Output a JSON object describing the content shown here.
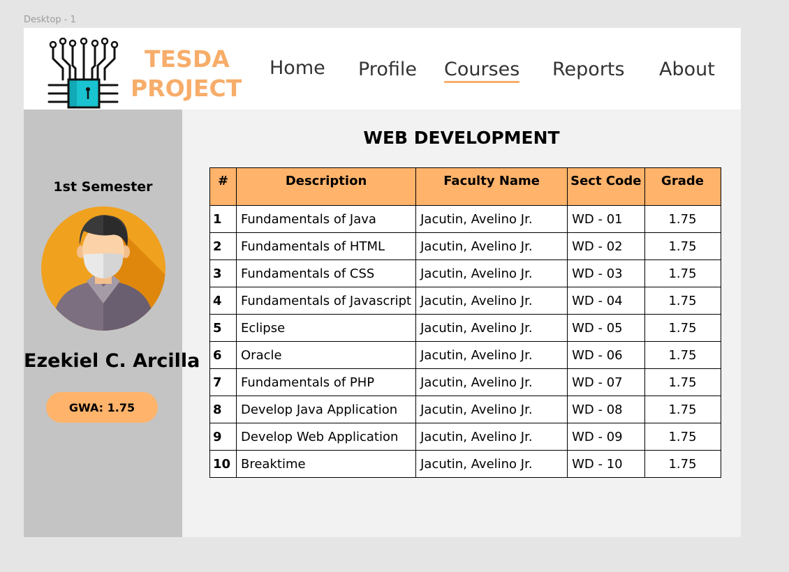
{
  "frame_label": "Desktop - 1",
  "brand": {
    "line1": "TESDA",
    "line2": "PROJECT"
  },
  "nav": [
    {
      "label": "Home"
    },
    {
      "label": "Profile"
    },
    {
      "label": "Courses"
    },
    {
      "label": "Reports"
    },
    {
      "label": "About"
    }
  ],
  "nav_active": "Courses",
  "sidebar": {
    "semester": "1st Semester",
    "student_name": "Ezekiel C. Arcilla",
    "gwa": "GWA: 1.75"
  },
  "course_title": "WEB DEVELOPMENT",
  "table": {
    "headers": [
      "#",
      "Description",
      "Faculty Name",
      "Sect Code",
      "Grade"
    ],
    "rows": [
      [
        "1",
        "Fundamentals of Java",
        "Jacutin, Avelino Jr.",
        "WD - 01",
        "1.75"
      ],
      [
        "2",
        "Fundamentals of HTML",
        "Jacutin, Avelino Jr.",
        "WD - 02",
        "1.75"
      ],
      [
        "3",
        "Fundamentals of CSS",
        "Jacutin, Avelino Jr.",
        "WD - 03",
        "1.75"
      ],
      [
        "4",
        "Fundamentals of Javascript",
        "Jacutin, Avelino Jr.",
        "WD - 04",
        "1.75"
      ],
      [
        "5",
        "Eclipse",
        "Jacutin, Avelino Jr.",
        "WD - 05",
        "1.75"
      ],
      [
        "6",
        "Oracle",
        "Jacutin, Avelino Jr.",
        "WD - 06",
        "1.75"
      ],
      [
        "7",
        "Fundamentals of PHP",
        "Jacutin, Avelino Jr.",
        "WD - 07",
        "1.75"
      ],
      [
        "8",
        "Develop Java Application",
        "Jacutin, Avelino Jr.",
        "WD - 08",
        "1.75"
      ],
      [
        "9",
        "Develop Web Application",
        "Jacutin, Avelino Jr.",
        "WD - 09",
        "1.75"
      ],
      [
        "10",
        "Breaktime",
        "Jacutin, Avelino Jr.",
        "WD - 10",
        "1.75"
      ]
    ]
  },
  "colors": {
    "accent": "#f7ad6a",
    "header_fill": "#ffb36b",
    "sidebar_bg": "#c4c4c4",
    "avatar_bg": "#f0a11e",
    "chip_teal": "#19c3d0"
  },
  "icons": {
    "logo": "circuit-chip-icon",
    "avatar": "masked-person-icon"
  }
}
